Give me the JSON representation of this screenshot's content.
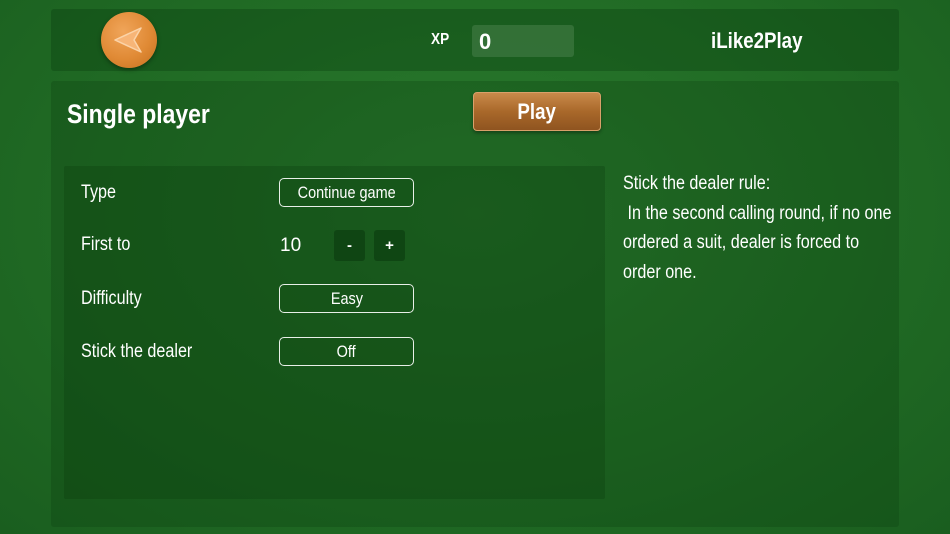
{
  "header": {
    "back_icon": "back-arrow-icon",
    "xp_label": "XP",
    "xp_value": "0",
    "username": "iLike2Play"
  },
  "main": {
    "title": "Single player",
    "play_label": "Play",
    "options": {
      "type_label": "Type",
      "type_value": "Continue game",
      "first_to_label": "First to",
      "first_to_value": "10",
      "decrement_label": "-",
      "increment_label": "+",
      "difficulty_label": "Difficulty",
      "difficulty_value": "Easy",
      "stick_label": "Stick the dealer",
      "stick_value": "Off"
    },
    "rule": {
      "title": "Stick the dealer rule:",
      "description": " In the second calling round, if no one ordered a suit, dealer is forced to order one."
    }
  },
  "colors": {
    "felt": "#1f6b24",
    "accent_orange": "#e08a35",
    "play_brown": "#a9682a"
  }
}
